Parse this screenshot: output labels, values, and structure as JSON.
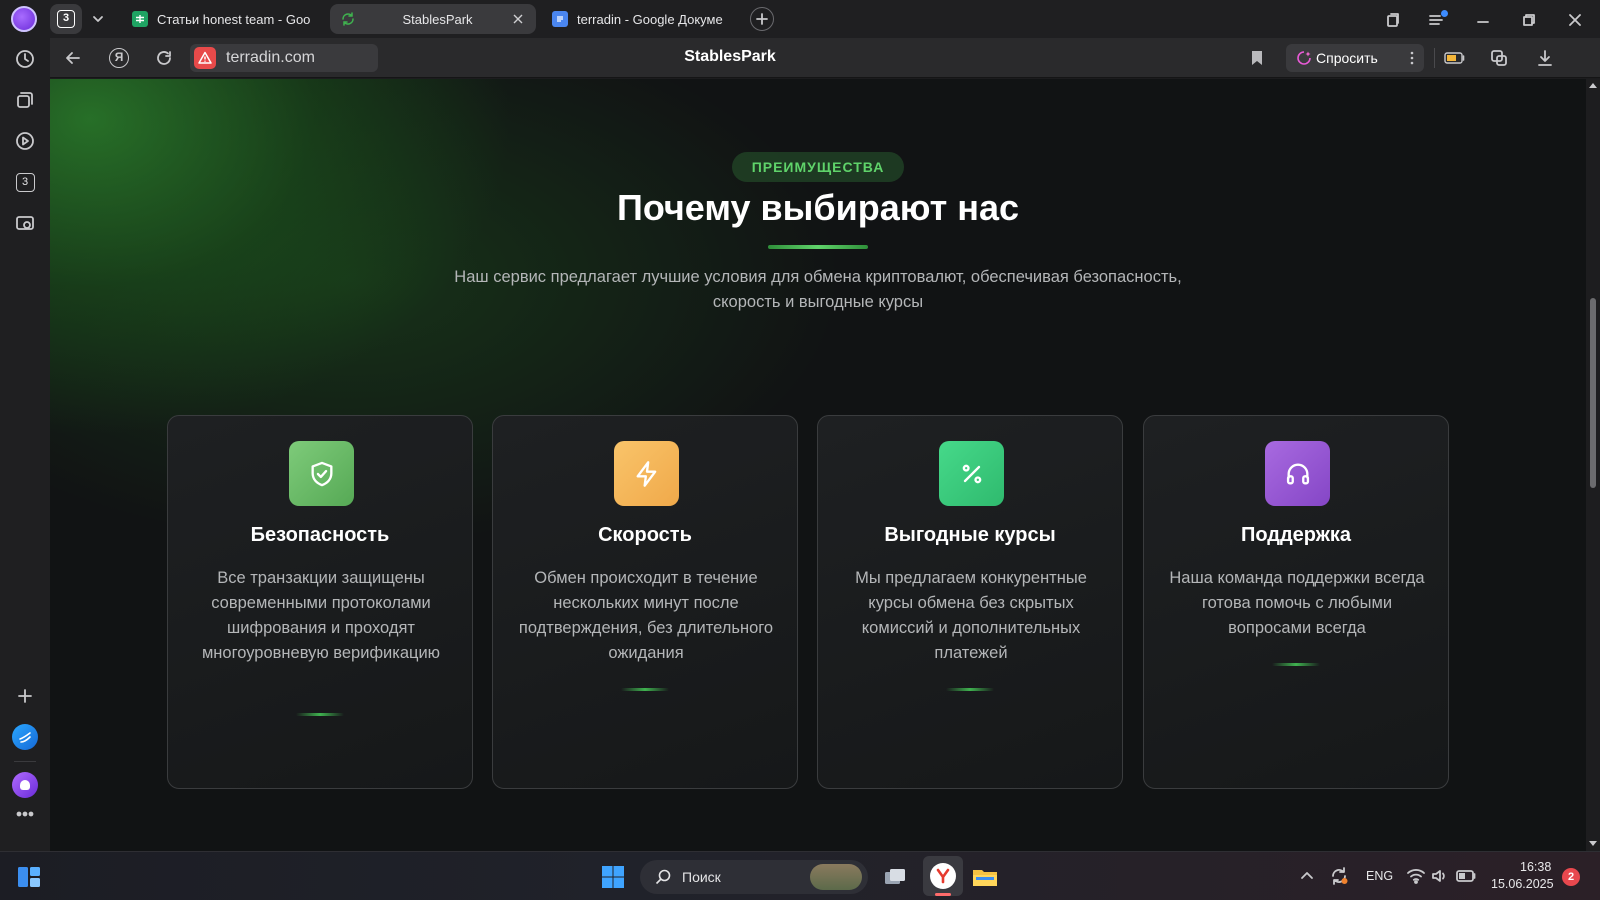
{
  "browser": {
    "tab_count_badge": "3",
    "tabs": [
      {
        "title": "Статьи honest team - Goo",
        "icon": "google-sheets-icon",
        "active": false
      },
      {
        "title": "StablesPark",
        "icon": "loading-icon",
        "active": true
      },
      {
        "title": "terradin - Google Докуме",
        "icon": "google-docs-icon",
        "active": false
      }
    ],
    "address": "terradin.com",
    "page_title": "StablesPark",
    "ask_button": "Спросить",
    "sidebar_badge": "3"
  },
  "section": {
    "eyebrow": "ПРЕИМУЩЕСТВА",
    "heading": "Почему выбирают нас",
    "subtitle": "Наш сервис предлагает лучшие условия для обмена криптовалют, обеспечивая безопасность, скорость и выгодные курсы",
    "accent_color": "#5fd36a",
    "cards": [
      {
        "title": "Безопасность",
        "text": "Все транзакции защищены современными протоколами шифрования и проходят многоуровневую верификацию",
        "icon": "shield-check-icon",
        "color": "#6cc06a"
      },
      {
        "title": "Скорость",
        "text": "Обмен происходит в течение нескольких минут после подтверждения, без длительного ожидания",
        "icon": "lightning-icon",
        "color": "#f5b85a"
      },
      {
        "title": "Выгодные курсы",
        "text": "Мы предлагаем конкурентные курсы обмена без скрытых комиссий и дополнительных платежей",
        "icon": "percent-icon",
        "color": "#3ccf7c"
      },
      {
        "title": "Поддержка",
        "text": "Наша команда поддержки всегда готова помочь с любыми вопросами всегда",
        "icon": "headphones-icon",
        "color": "#9a5ad6"
      }
    ]
  },
  "taskbar": {
    "search_placeholder": "Поиск",
    "language": "ENG",
    "time": "16:38",
    "date": "15.06.2025",
    "notifications": "2"
  }
}
